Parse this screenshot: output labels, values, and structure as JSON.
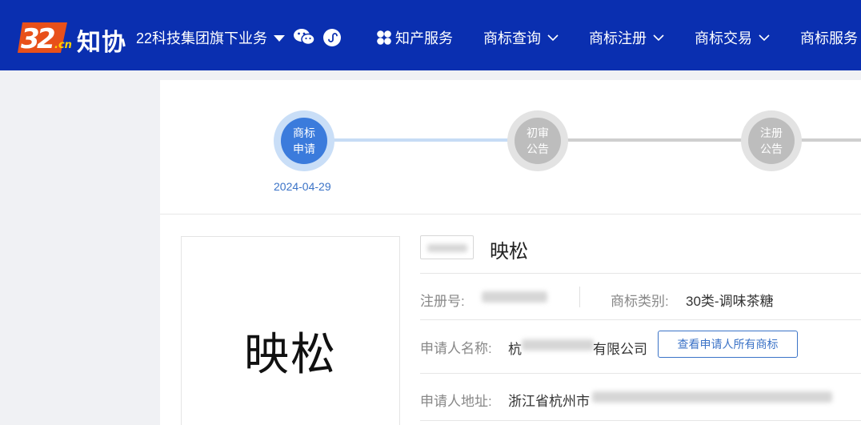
{
  "header": {
    "logo_text": "知协",
    "logo_mark": "32.cn",
    "group_label": "22科技集团旗下业务",
    "icons": [
      "wechat-icon",
      "mini-program-icon"
    ],
    "nav": [
      {
        "label": "知产服务",
        "icon": "grid-icon",
        "has_dropdown": false
      },
      {
        "label": "商标查询",
        "has_dropdown": true
      },
      {
        "label": "商标注册",
        "has_dropdown": true
      },
      {
        "label": "商标交易",
        "has_dropdown": true
      },
      {
        "label": "商标服务",
        "has_dropdown": false
      }
    ]
  },
  "steps": [
    {
      "label_line1": "商标",
      "label_line2": "申请",
      "date": "2024-04-29",
      "active": true
    },
    {
      "label_line1": "初审",
      "label_line2": "公告",
      "date": "",
      "active": false
    },
    {
      "label_line1": "注册",
      "label_line2": "公告",
      "date": "",
      "active": false
    }
  ],
  "trademark": {
    "image_text": "映松",
    "name": "映松"
  },
  "details": {
    "reg_no_label": "注册号:",
    "category_label": "商标类别:",
    "category_value": "30类-调味茶糖",
    "applicant_label": "申请人名称:",
    "applicant_prefix": "杭",
    "applicant_suffix": "有限公司",
    "view_all_button": "查看申请人所有商标",
    "address_label": "申请人地址:",
    "address_value": "浙江省杭州市"
  },
  "colors": {
    "header_bg": "#0a2fb0",
    "active_step": "#3b7bdc",
    "inactive_step": "#bdbdbd",
    "accent": "#3b73c7"
  }
}
